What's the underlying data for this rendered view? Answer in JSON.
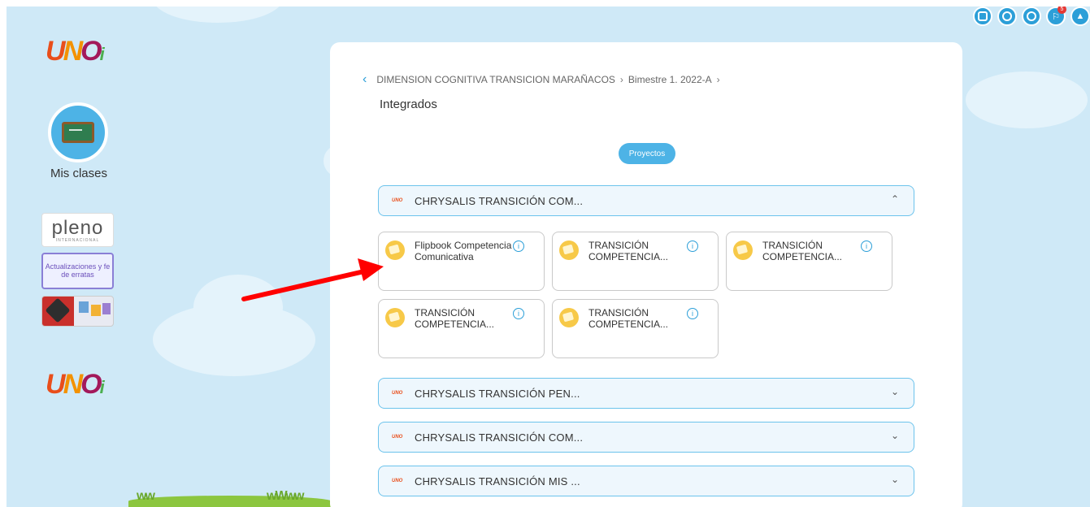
{
  "sidebar": {
    "mis_clases": "Mis clases",
    "banner_pleno": "pleno",
    "banner_pleno_sub": "INTERNACIONAL",
    "banner_actualizaciones": "Actualizaciones y fe de erratas"
  },
  "header": {
    "notifications_count": "5",
    "icons": [
      "calculator-icon",
      "clock-icon",
      "mail-icon",
      "bell-icon",
      "org-chart-icon"
    ]
  },
  "main": {
    "breadcrumb": {
      "course": "DIMENSION COGNITIVA TRANSICION MARAÑACOS",
      "period": "Bimestre 1. 2022-A"
    },
    "title": "Integrados",
    "tab": "Proyectos",
    "accordions": [
      {
        "label": "CHRYSALIS TRANSICIÓN COM...",
        "expanded": true,
        "items": [
          "Flipbook Competencia Comunicativa",
          "TRANSICIÓN COMPETENCIA...",
          "TRANSICIÓN COMPETENCIA...",
          "TRANSICIÓN COMPETENCIA...",
          "TRANSICIÓN COMPETENCIA..."
        ]
      },
      {
        "label": "CHRYSALIS TRANSICIÓN PEN...",
        "expanded": false
      },
      {
        "label": "CHRYSALIS TRANSICIÓN COM...",
        "expanded": false
      },
      {
        "label": "CHRYSALIS TRANSICIÓN MIS ...",
        "expanded": false
      }
    ]
  },
  "colors": {
    "accent": "#2c9fd8",
    "background": "#cfe9f7",
    "annotation_arrow": "#ff0000"
  }
}
